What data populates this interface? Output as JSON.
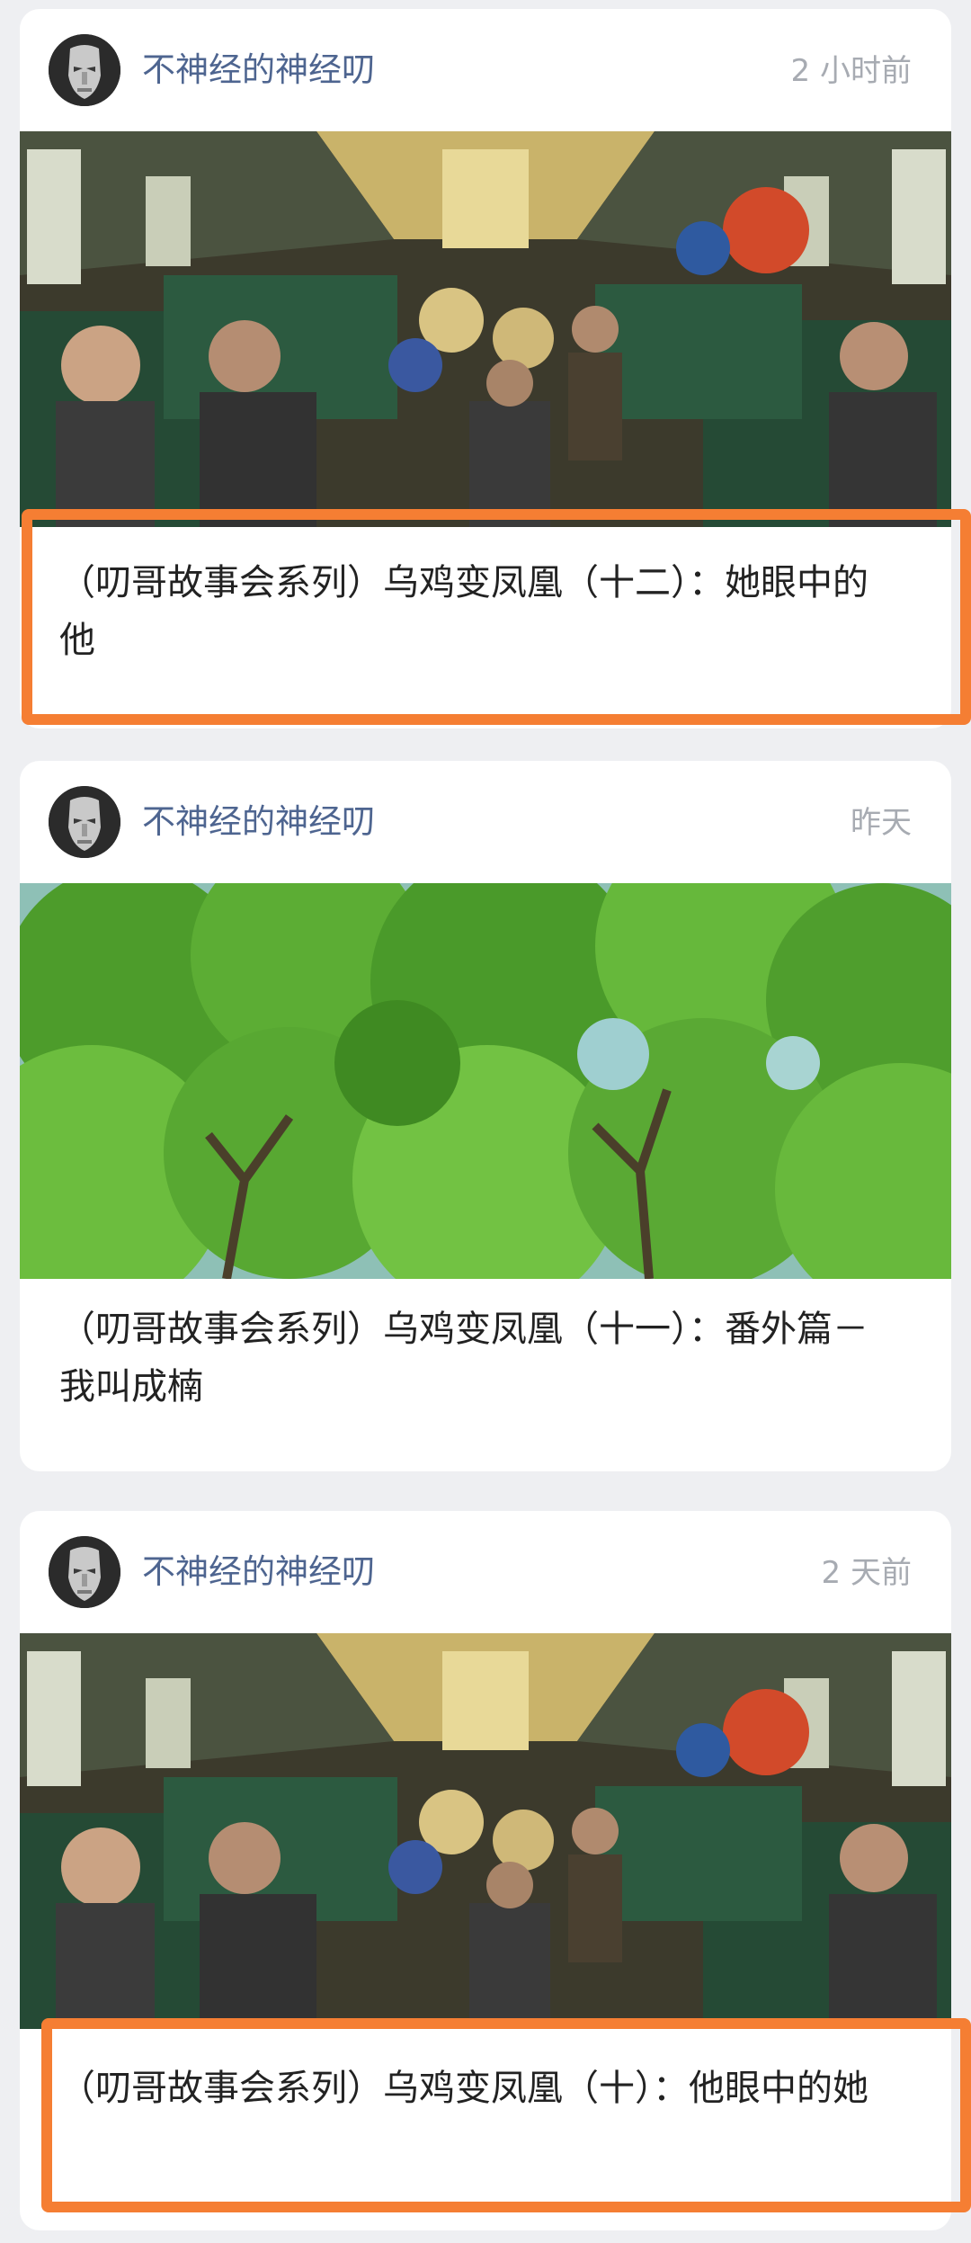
{
  "posts": [
    {
      "author": "不神经的神经叨",
      "time": "2 小时前",
      "title": "（叨哥故事会系列）乌鸡变凤凰（十二）：她眼中的他",
      "cover": "train-interior-photo",
      "highlighted": true
    },
    {
      "author": "不神经的神经叨",
      "time": "昨天",
      "title": "（叨哥故事会系列）乌鸡变凤凰（十一）：番外篇－我叫成楠",
      "cover": "tree-canopy-photo",
      "highlighted": false
    },
    {
      "author": "不神经的神经叨",
      "time": "2 天前",
      "title": "（叨哥故事会系列）乌鸡变凤凰（十）：他眼中的她",
      "cover": "train-interior-photo",
      "highlighted": true
    }
  ],
  "colors": {
    "highlight": "#f57e33",
    "author": "#4e6590",
    "time": "#a7abb2"
  }
}
